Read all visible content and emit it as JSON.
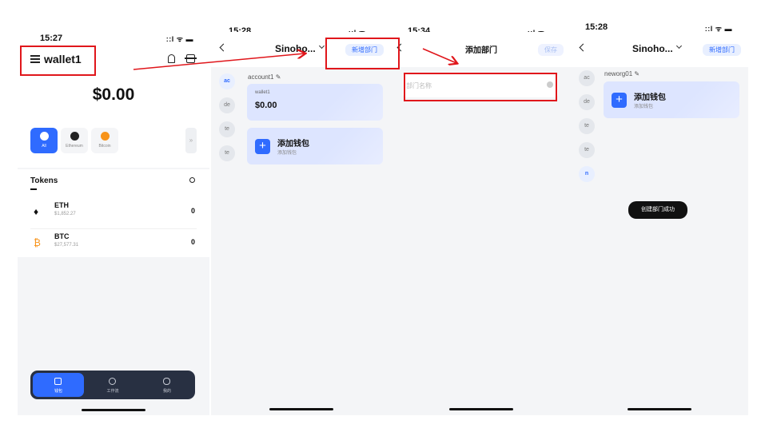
{
  "screen1": {
    "time": "15:27",
    "signal": "::l ᯤ ▬",
    "wallet_title": "wallet1",
    "balance": "$0.00",
    "chains": [
      {
        "label": "All",
        "icon": "all-chains-icon"
      },
      {
        "label": "Ethereum",
        "icon": "ethereum-icon"
      },
      {
        "label": "Bitcoin",
        "icon": "bitcoin-icon"
      }
    ],
    "chains_more": "»",
    "tokens_title": "Tokens",
    "tokens": [
      {
        "name": "ETH",
        "price": "$1,852.27",
        "amount": "0",
        "icon": "♦"
      },
      {
        "name": "BTC",
        "price": "$27,577.31",
        "amount": "0",
        "icon": "₿"
      }
    ],
    "tabs": [
      "钱包",
      "工作流",
      "我的"
    ]
  },
  "screen2": {
    "time": "15:28",
    "signal": "::l ᯤ ▬",
    "org_title": "Sinoho...",
    "add_dept_button": "新增部门",
    "sidebar": [
      "ac",
      "de",
      "te",
      "te"
    ],
    "account_label": "account1 ✎",
    "wallet_card": {
      "name": "wallet1",
      "balance": "$0.00"
    },
    "add_wallet": {
      "title": "添加钱包",
      "subtitle": "添加钱包"
    }
  },
  "screen3": {
    "time": "15:34",
    "signal": "::l ᯤ ▬",
    "title": "添加部门",
    "save_button": "保存",
    "input_placeholder": "部门名称"
  },
  "screen4": {
    "time": "15:28",
    "signal": "::l ᯤ ▬",
    "org_title": "Sinoho...",
    "add_dept_button": "新增部门",
    "sidebar": [
      "ac",
      "de",
      "te",
      "te",
      "n"
    ],
    "account_label": "neworg01 ✎",
    "add_wallet": {
      "title": "添加钱包",
      "subtitle": "添加钱包"
    },
    "toast": "创建部门成功"
  },
  "colors": {
    "accent": "#2f6bff",
    "annotation": "#e0161b",
    "tabbar": "#283042"
  }
}
